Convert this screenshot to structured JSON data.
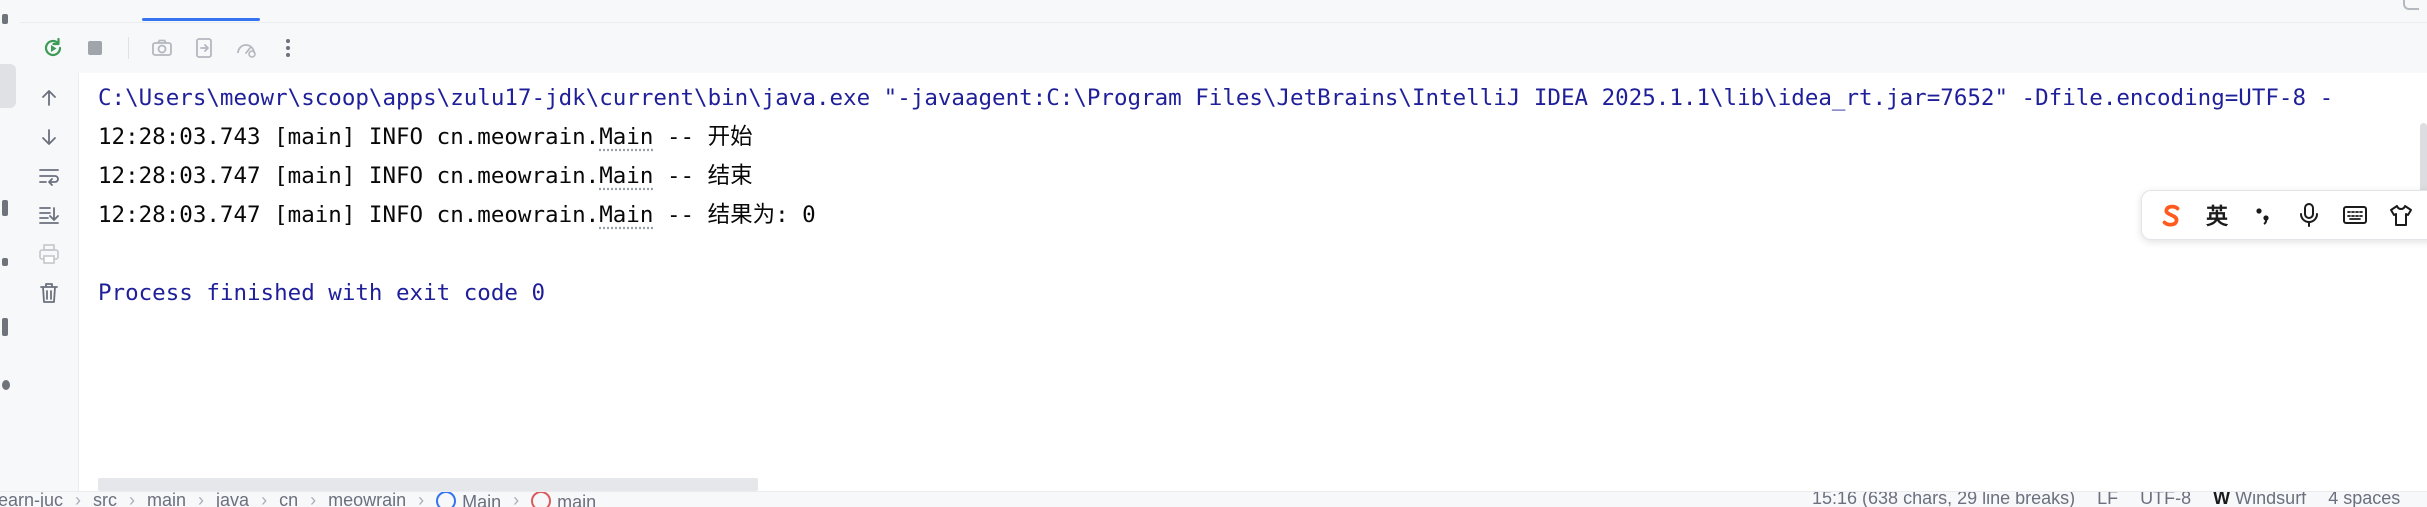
{
  "console": {
    "command_line": "C:\\Users\\meowr\\scoop\\apps\\zulu17-jdk\\current\\bin\\java.exe \"-javaagent:C:\\Program Files\\JetBrains\\IntelliJ IDEA 2025.1.1\\lib\\idea_rt.jar=7652\" -Dfile.encoding=UTF-8 -",
    "log_lines": [
      {
        "prefix": "12:28:03.743 [main] INFO cn.meowrain.",
        "cls": "Main",
        "msg": " -- 开始"
      },
      {
        "prefix": "12:28:03.747 [main] INFO cn.meowrain.",
        "cls": "Main",
        "msg": " -- 结束"
      },
      {
        "prefix": "12:28:03.747 [main] INFO cn.meowrain.",
        "cls": "Main",
        "msg": " -- 结果为: 0"
      }
    ],
    "finish_line": "Process finished with exit code 0"
  },
  "run_toolbar": {
    "icons": [
      "rerun-icon",
      "stop-icon",
      "camera-icon",
      "exit-icon",
      "speed-icon",
      "more-options-icon"
    ]
  },
  "console_toolbar": {
    "icons": [
      "scroll-up-icon",
      "scroll-down-icon",
      "soft-wrap-icon",
      "scroll-to-end-icon",
      "print-icon",
      "clear-all-icon"
    ]
  },
  "ime_bar": {
    "language": "英",
    "icons": [
      "sogou-logo-icon",
      "punctuation-icon",
      "microphone-icon",
      "keyboard-icon",
      "skin-icon"
    ],
    "brand_color": "#ff5a1f"
  },
  "status_bar": {
    "breadcrumbs": [
      "learn-juc",
      "src",
      "main",
      "java",
      "cn",
      "meowrain",
      "Main",
      "main"
    ],
    "caret_info": "15:16 (638 chars, 29 line breaks)",
    "line_separator": "LF",
    "encoding": "UTF-8",
    "ai_plugin": "Windsurf",
    "indent": "4 spaces"
  },
  "colors": {
    "command_text": "#1f1f99",
    "log_text": "#080808",
    "accent": "#3574f0",
    "rerun_green": "#3e9a57"
  }
}
